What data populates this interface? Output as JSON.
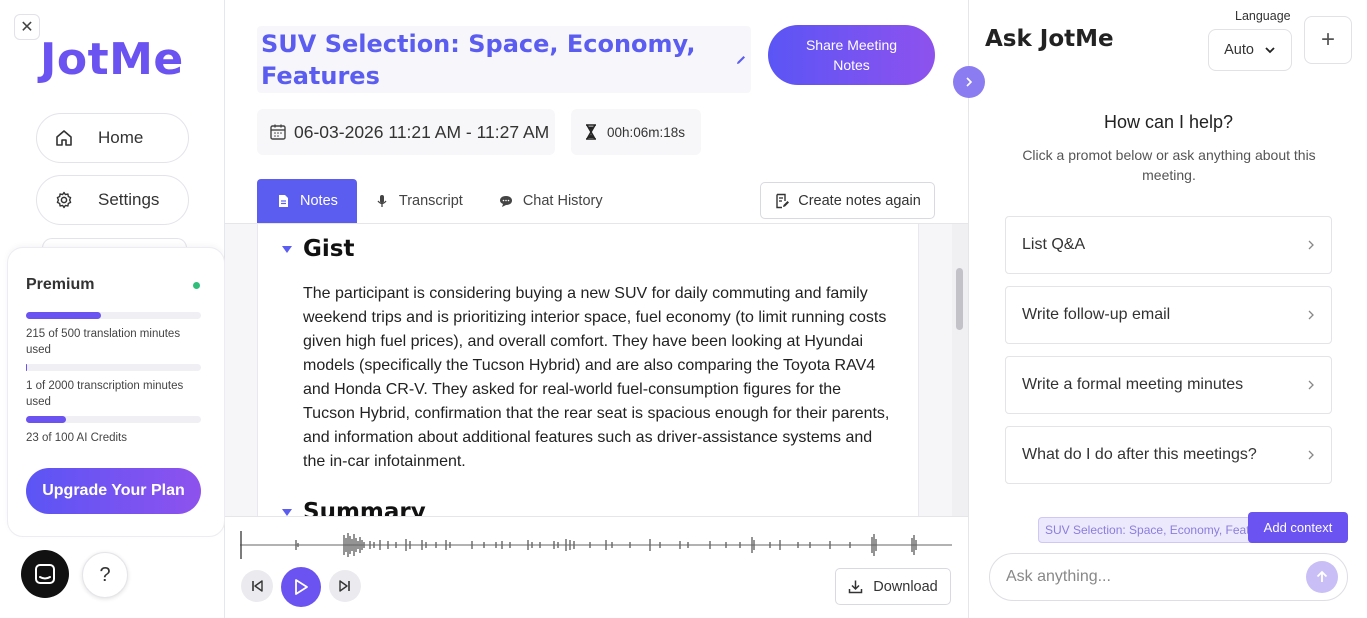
{
  "sidebar": {
    "logo": "JotMe",
    "nav": [
      {
        "label": "Home",
        "icon": "home-icon"
      },
      {
        "label": "Settings",
        "icon": "gear-icon"
      }
    ],
    "premium": {
      "title": "Premium",
      "status_color": "#2fbf7a",
      "usage": [
        {
          "label": "215 of 500 translation minutes used",
          "used": 215,
          "total": 500
        },
        {
          "label": "1 of 2000 transcription minutes used",
          "used": 1,
          "total": 2000
        },
        {
          "label": "23 of 100 AI Credits",
          "used": 23,
          "total": 100
        }
      ],
      "upgrade_label": "Upgrade Your Plan"
    },
    "help_label": "?"
  },
  "meeting": {
    "title": "SUV Selection: Space, Economy, Features",
    "share_label": "Share Meeting Notes",
    "date_range": "06-03-2026 11:21 AM - 11:27 AM",
    "duration": "00h:06m:18s",
    "tabs": [
      {
        "label": "Notes",
        "icon": "document-icon",
        "active": true
      },
      {
        "label": "Transcript",
        "icon": "microphone-icon",
        "active": false
      },
      {
        "label": "Chat History",
        "icon": "chat-icon",
        "active": false
      }
    ],
    "recreate_label": "Create notes again",
    "sections": [
      {
        "heading": "Gist",
        "body": "The participant is considering buying a new SUV for daily commuting and family weekend trips and is prioritizing interior space, fuel economy (to limit running costs given high fuel prices), and overall comfort. They have been looking at Hyundai models (specifically the Tucson Hybrid) and are also comparing the Toyota RAV4 and Honda CR-V. They asked for real-world fuel-consumption figures for the Tucson Hybrid, confirmation that the rear seat is spacious enough for their parents, and information about additional features such as driver-assistance systems and the in-car infotainment."
      },
      {
        "heading": "Summary"
      }
    ],
    "player": {
      "download_label": "Download"
    }
  },
  "assistant": {
    "title": "Ask JotMe",
    "language_label": "Language",
    "language_value": "Auto",
    "new_label": "+",
    "help_title": "How can I help?",
    "help_subtitle": "Click a promot below or ask anything about this meeting.",
    "prompts": [
      "List Q&A",
      "Write follow-up email",
      "Write a formal meeting minutes",
      "What do I do after this meetings?"
    ],
    "context_chip": "SUV Selection: Space, Economy, Features",
    "add_context_label": "Add context",
    "input_placeholder": "Ask anything..."
  },
  "colors": {
    "accent": "#5b5cf0",
    "brand_gradient_start": "#5b55f5",
    "brand_gradient_end": "#8e52ee"
  }
}
